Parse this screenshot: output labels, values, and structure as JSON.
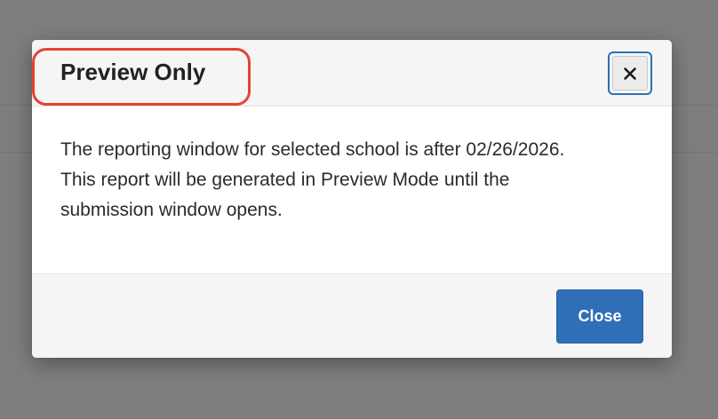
{
  "dialog": {
    "title": "Preview Only",
    "close_icon": "close-icon",
    "message_lines": [
      "The reporting window for selected school is after 02/26/2026.",
      "This report will be generated in Preview Mode until the",
      "submission window opens."
    ],
    "close_button_label": "Close"
  },
  "colors": {
    "overlay": "#7e7e7e",
    "highlight": "#e5432f",
    "primary": "#2f6fb8"
  }
}
